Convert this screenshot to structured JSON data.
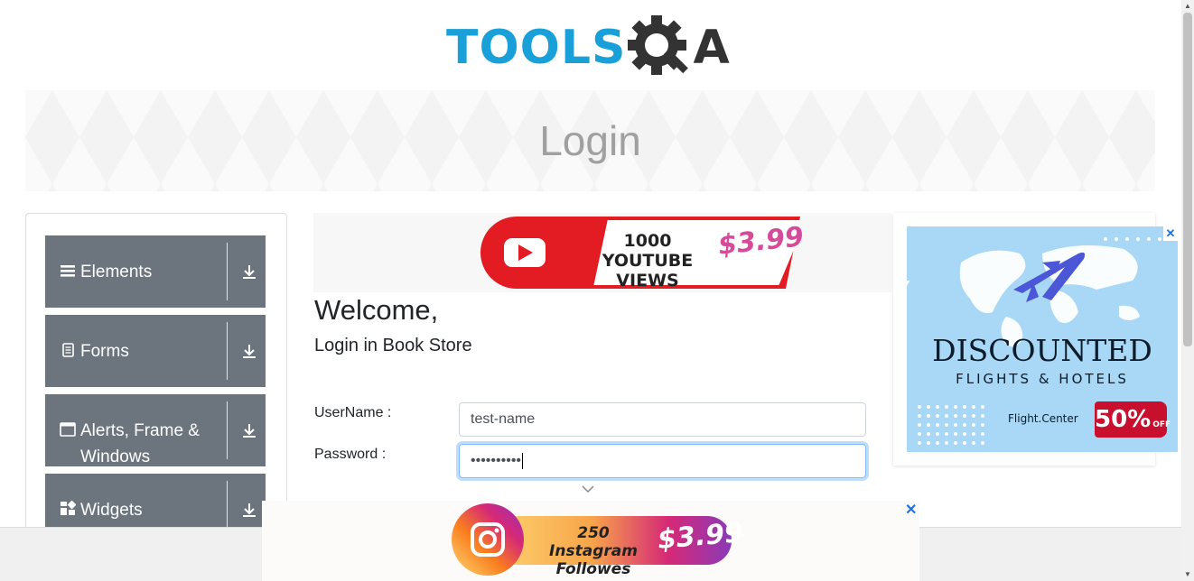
{
  "logo": {
    "part1": "TOOLS",
    "part2": "A"
  },
  "header": {
    "title": "Login"
  },
  "sidebar": {
    "groups": [
      {
        "label": "Elements",
        "icon": "hamburger-icon"
      },
      {
        "label": "Forms",
        "icon": "document-icon"
      },
      {
        "label": "Alerts, Frame & Windows",
        "icon": "window-icon"
      },
      {
        "label": "Widgets",
        "icon": "widgets-icon"
      }
    ]
  },
  "ads": {
    "top": {
      "line1": "1000",
      "line2": "YOUTUBE VIEWS",
      "price": "$3.99"
    },
    "right": {
      "title": "DISCOUNTED",
      "subtitle": "FLIGHTS & HOTELS",
      "brand": "Flight.Center",
      "discount": "50%",
      "off": "OFF",
      "close": "✕"
    },
    "bottom": {
      "line1": "250 Instagram",
      "line2": "Followes",
      "price": "$3.99",
      "close": "✕"
    }
  },
  "form": {
    "welcome": "Welcome,",
    "subtitle": "Login in Book Store",
    "username_label": "UserName :",
    "username_value": "test-name",
    "password_label": "Password :",
    "password_value": "••••••••••"
  },
  "colors": {
    "sidebar_bg": "#6c757d",
    "logo_blue": "#1aa0d8",
    "focus_border": "#80bdff"
  }
}
